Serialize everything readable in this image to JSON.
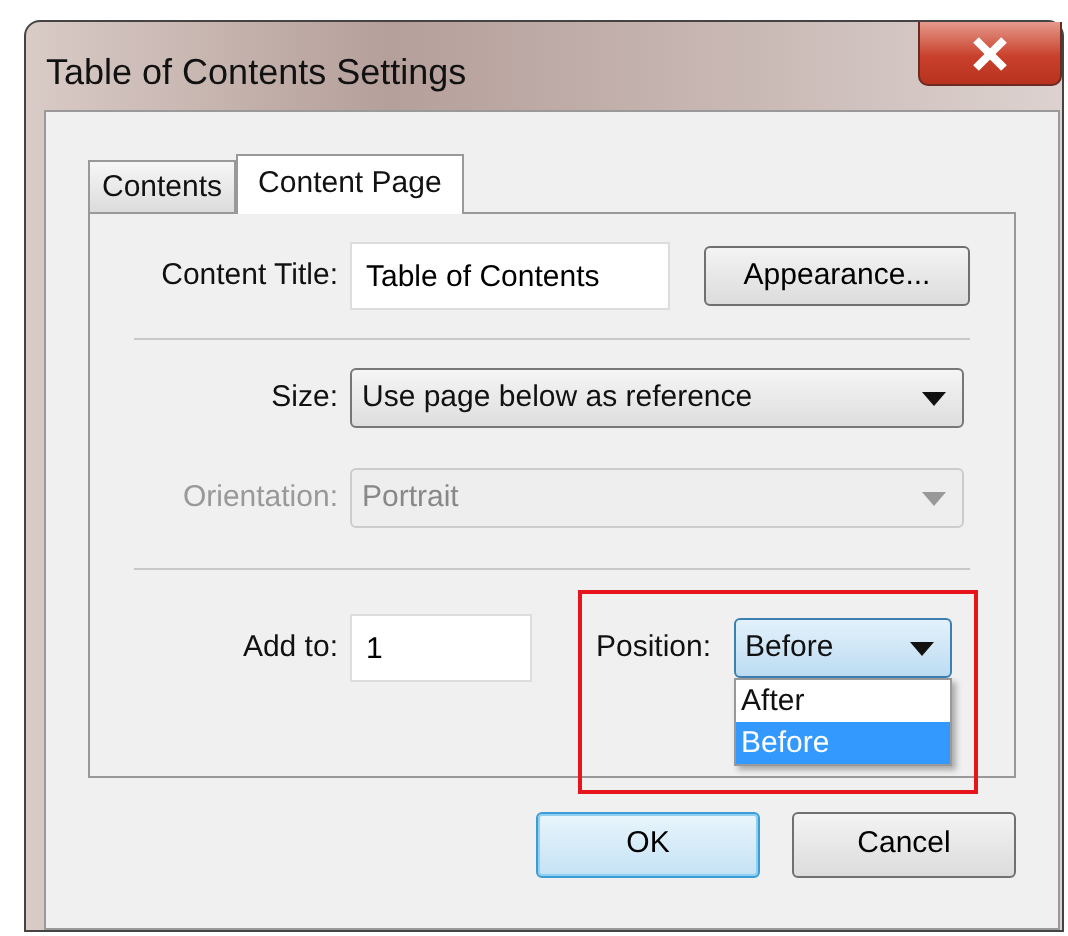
{
  "window": {
    "title": "Table of Contents Settings"
  },
  "tabs": [
    {
      "label": "Contents",
      "selected": false
    },
    {
      "label": "Content Page",
      "selected": true
    }
  ],
  "content_title": {
    "label": "Content Title:",
    "value": "Table of Contents"
  },
  "appearance_button": "Appearance...",
  "size": {
    "label": "Size:",
    "value": "Use page below as reference",
    "disabled": false
  },
  "orientation": {
    "label": "Orientation:",
    "value": "Portrait",
    "disabled": true
  },
  "add_to": {
    "label": "Add to:",
    "value": "1"
  },
  "position": {
    "label": "Position:",
    "value": "Before",
    "expanded": true,
    "highlighted": true,
    "options": [
      {
        "label": "After",
        "selected": false
      },
      {
        "label": "Before",
        "selected": true
      }
    ]
  },
  "buttons": [
    {
      "label": "OK",
      "default": true
    },
    {
      "label": "Cancel",
      "default": false
    }
  ]
}
